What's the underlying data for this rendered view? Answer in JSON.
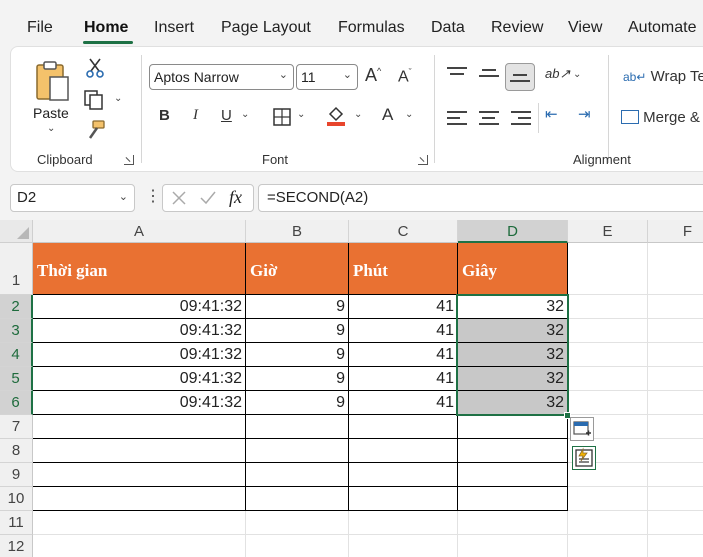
{
  "menu": {
    "tabs": [
      {
        "label": "File"
      },
      {
        "label": "Home"
      },
      {
        "label": "Insert"
      },
      {
        "label": "Page Layout"
      },
      {
        "label": "Formulas"
      },
      {
        "label": "Data"
      },
      {
        "label": "Review"
      },
      {
        "label": "View"
      },
      {
        "label": "Automate"
      }
    ],
    "active_tab": "Home",
    "accent_color": "#1e7145"
  },
  "ribbon": {
    "clipboard": {
      "paste_label": "Paste",
      "group_label": "Clipboard"
    },
    "font": {
      "font_name": "Aptos Narrow",
      "font_size": "11",
      "grow_label": "A",
      "shrink_label": "A",
      "bold_label": "B",
      "italic_label": "I",
      "underline_label": "U",
      "font_color_label": "A",
      "fill_color": "#e8452c",
      "group_label": "Font"
    },
    "alignment": {
      "wrap_text_label": "Wrap Te",
      "merge_label": "Merge &",
      "orientation_label": "ab",
      "group_label": "Alignment"
    }
  },
  "formula_bar": {
    "name_box": "D2",
    "fx_label": "fx",
    "formula": "=SECOND(A2)"
  },
  "sheet": {
    "columns": [
      "A",
      "B",
      "C",
      "D",
      "E",
      "F"
    ],
    "row_numbers": [
      "1",
      "2",
      "3",
      "4",
      "5",
      "6",
      "7",
      "8",
      "9",
      "10",
      "11",
      "12"
    ],
    "selected_column": "D",
    "selected_range": "D2:D6",
    "header_fill": "#e97132",
    "headers": [
      "Thời gian",
      "Giờ",
      "Phút",
      "Giây"
    ],
    "rows": [
      [
        "09:41:32",
        "9",
        "41",
        "32"
      ],
      [
        "09:41:32",
        "9",
        "41",
        "32"
      ],
      [
        "09:41:32",
        "9",
        "41",
        "32"
      ],
      [
        "09:41:32",
        "9",
        "41",
        "32"
      ],
      [
        "09:41:32",
        "9",
        "41",
        "32"
      ]
    ]
  }
}
